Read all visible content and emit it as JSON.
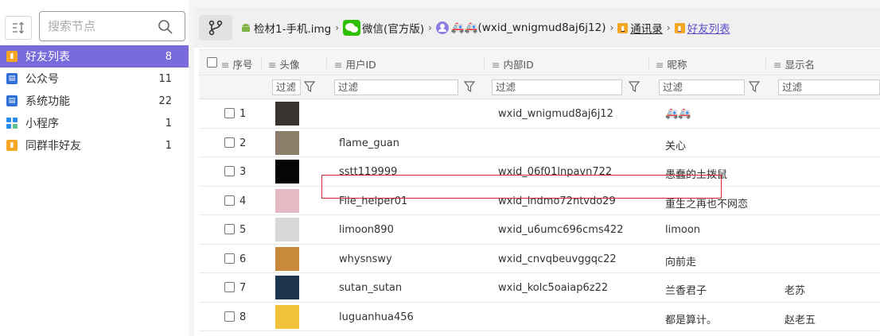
{
  "sidebar": {
    "search_placeholder": "搜索节点",
    "items": [
      {
        "label": "好友列表",
        "count": "8",
        "icon": "contact-book-icon",
        "color": "#f5a623"
      },
      {
        "label": "公众号",
        "count": "11",
        "icon": "official-account-icon",
        "color": "#2f6fd6"
      },
      {
        "label": "系统功能",
        "count": "22",
        "icon": "system-icon",
        "color": "#2f6fd6"
      },
      {
        "label": "小程序",
        "count": "1",
        "icon": "mini-program-icon",
        "color": "#2a8cf0"
      },
      {
        "label": "同群非好友",
        "count": "1",
        "icon": "contact-book-icon",
        "color": "#f5a623"
      }
    ]
  },
  "breadcrumb": {
    "items": [
      {
        "label": "检材1-手机.img",
        "icon": "android-icon"
      },
      {
        "label": "微信(官方版)",
        "icon": "wechat-icon"
      },
      {
        "label": "🚑🚑(wxid_wnigmud8aj6j12)",
        "icon": "user-icon"
      },
      {
        "label": "通讯录",
        "icon": "contact-book-icon"
      },
      {
        "label": "好友列表",
        "icon": "contact-book-icon"
      }
    ]
  },
  "table": {
    "columns": [
      "序号",
      "头像",
      "用户ID",
      "内部ID",
      "昵称",
      "显示名"
    ],
    "filter_label": "过滤",
    "rows": [
      {
        "no": "1",
        "user_id": "",
        "internal_id": "wxid_wnigmud8aj6j12",
        "nickname": "🚑🚑",
        "display": "",
        "avatar": "#3a3430"
      },
      {
        "no": "2",
        "user_id": "flame_guan",
        "internal_id": "",
        "nickname": "关心",
        "display": "",
        "avatar": "#8c7c6a"
      },
      {
        "no": "3",
        "user_id": "sstt119999",
        "internal_id": "wxid_06f01lnpavn722",
        "nickname": "愚蠢的土拨鼠",
        "display": "",
        "avatar": "#050505"
      },
      {
        "no": "4",
        "user_id": "File_helper01",
        "internal_id": "wxid_lndmo72ntvdo29",
        "nickname": "重生之再也不网恋",
        "display": "",
        "avatar": "#e7b9c4"
      },
      {
        "no": "5",
        "user_id": "limoon890",
        "internal_id": "wxid_u6umc696cms422",
        "nickname": "limoon",
        "display": "",
        "avatar": "#d8d8d8"
      },
      {
        "no": "6",
        "user_id": "whysnswy",
        "internal_id": "wxid_cnvqbeuvggqc22",
        "nickname": "向前走",
        "display": "",
        "avatar": "#c88a3a"
      },
      {
        "no": "7",
        "user_id": "sutan_sutan",
        "internal_id": "wxid_kolc5oaiap6z22",
        "nickname": "兰香君子",
        "display": "老苏",
        "avatar": "#1e3550"
      },
      {
        "no": "8",
        "user_id": "luguanhua456",
        "internal_id": "",
        "nickname": "都是算计。",
        "display": "赵老五",
        "avatar": "#f0c23a"
      }
    ]
  },
  "colors": {
    "accent": "#7a6bdc",
    "highlight": "#d0282d"
  }
}
